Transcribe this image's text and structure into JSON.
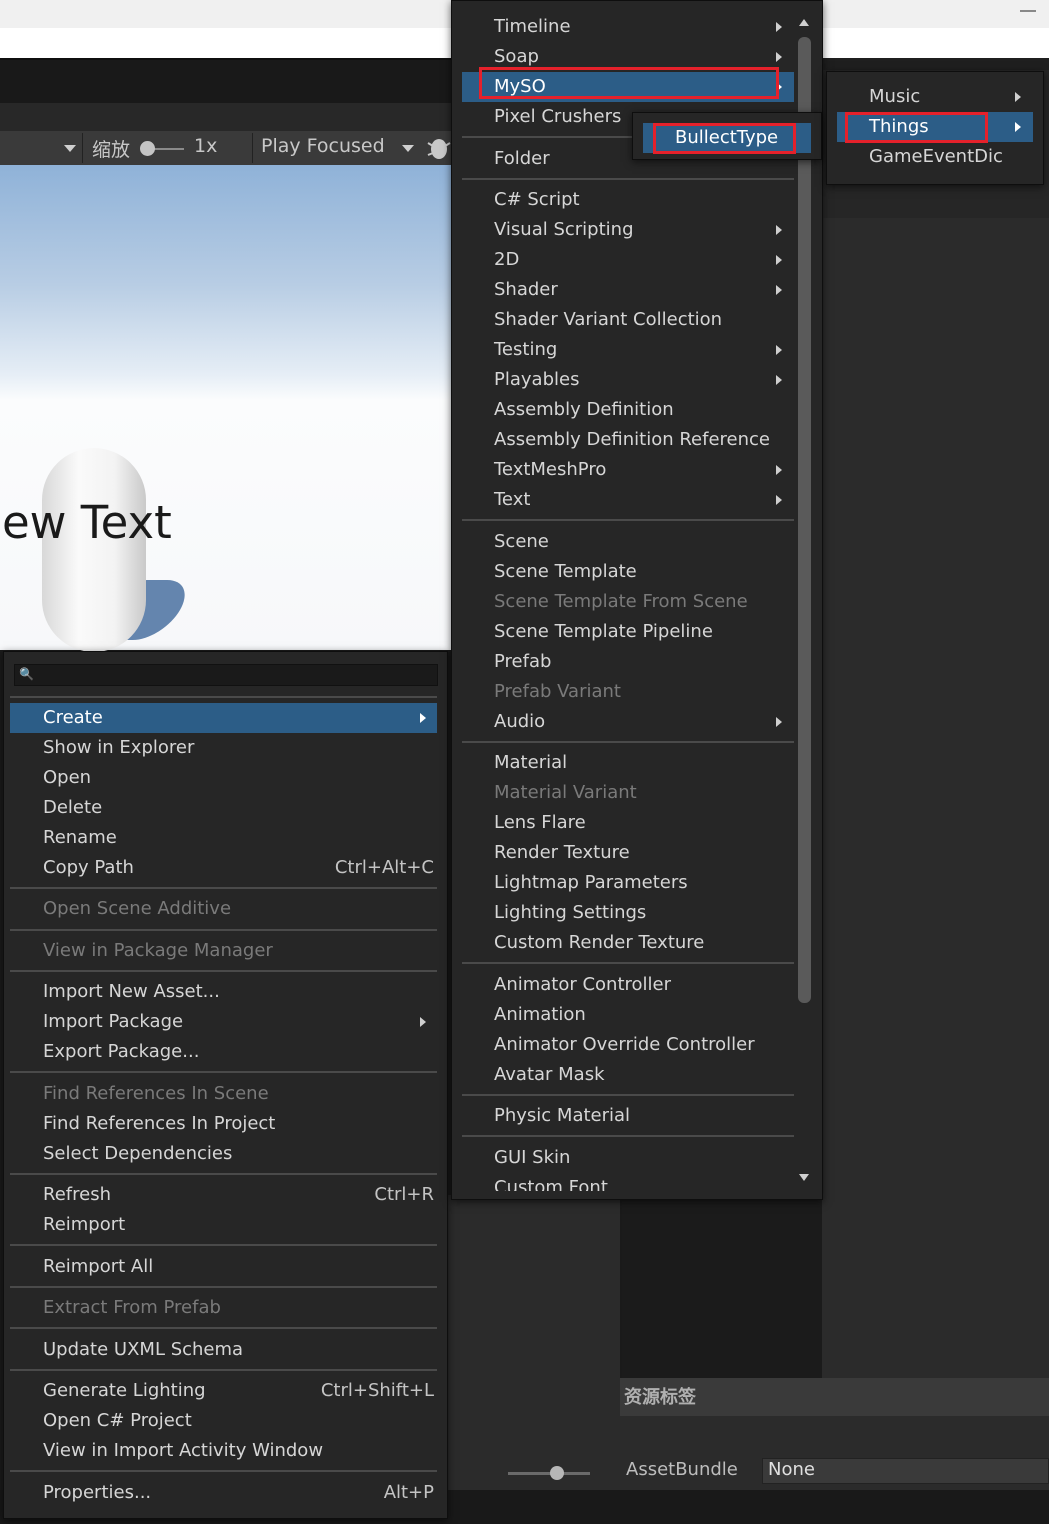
{
  "game_toolbar": {
    "scale_label": "缩放",
    "scale_value": "1x",
    "play_mode": "Play Focused"
  },
  "scene": {
    "text_label": "ew Text"
  },
  "inspector": {
    "asset_labels_title": "资源标签",
    "assetbundle_label": "AssetBundle",
    "assetbundle_value": "None"
  },
  "context_menu": {
    "search_placeholder": "",
    "items": [
      {
        "label": "Create",
        "selected": true,
        "submenu": true
      },
      {
        "label": "Show in Explorer"
      },
      {
        "label": "Open"
      },
      {
        "label": "Delete"
      },
      {
        "label": "Rename"
      },
      {
        "label": "Copy Path",
        "shortcut": "Ctrl+Alt+C"
      },
      {
        "label": "Open Scene Additive",
        "disabled": true
      },
      {
        "label": "View in Package Manager",
        "disabled": true
      },
      {
        "label": "Import New Asset..."
      },
      {
        "label": "Import Package",
        "submenu": true
      },
      {
        "label": "Export Package..."
      },
      {
        "label": "Find References In Scene",
        "disabled": true
      },
      {
        "label": "Find References In Project"
      },
      {
        "label": "Select Dependencies"
      },
      {
        "label": "Refresh",
        "shortcut": "Ctrl+R"
      },
      {
        "label": "Reimport"
      },
      {
        "label": "Reimport All"
      },
      {
        "label": "Extract From Prefab",
        "disabled": true
      },
      {
        "label": "Update UXML Schema"
      },
      {
        "label": "Generate Lighting",
        "shortcut": "Ctrl+Shift+L"
      },
      {
        "label": "Open C# Project"
      },
      {
        "label": "View in Import Activity Window"
      },
      {
        "label": "Properties...",
        "shortcut": "Alt+P"
      }
    ]
  },
  "create_menu": {
    "items": [
      {
        "label": "Timeline",
        "submenu": true
      },
      {
        "label": "Soap",
        "submenu": true
      },
      {
        "label": "MySO",
        "selected": true,
        "submenu": true
      },
      {
        "label": "Pixel Crushers",
        "submenu": true
      },
      {
        "label": "Folder"
      },
      {
        "label": "C# Script"
      },
      {
        "label": "Visual Scripting",
        "submenu": true
      },
      {
        "label": "2D",
        "submenu": true
      },
      {
        "label": "Shader",
        "submenu": true
      },
      {
        "label": "Shader Variant Collection"
      },
      {
        "label": "Testing",
        "submenu": true
      },
      {
        "label": "Playables",
        "submenu": true
      },
      {
        "label": "Assembly Definition"
      },
      {
        "label": "Assembly Definition Reference"
      },
      {
        "label": "TextMeshPro",
        "submenu": true
      },
      {
        "label": "Text",
        "submenu": true
      },
      {
        "label": "Scene"
      },
      {
        "label": "Scene Template"
      },
      {
        "label": "Scene Template From Scene",
        "disabled": true
      },
      {
        "label": "Scene Template Pipeline"
      },
      {
        "label": "Prefab"
      },
      {
        "label": "Prefab Variant",
        "disabled": true
      },
      {
        "label": "Audio",
        "submenu": true
      },
      {
        "label": "Material"
      },
      {
        "label": "Material Variant",
        "disabled": true
      },
      {
        "label": "Lens Flare"
      },
      {
        "label": "Render Texture"
      },
      {
        "label": "Lightmap Parameters"
      },
      {
        "label": "Lighting Settings"
      },
      {
        "label": "Custom Render Texture"
      },
      {
        "label": "Animator Controller"
      },
      {
        "label": "Animation"
      },
      {
        "label": "Animator Override Controller"
      },
      {
        "label": "Avatar Mask"
      },
      {
        "label": "Physic Material"
      },
      {
        "label": "GUI Skin"
      },
      {
        "label": "Custom Font"
      }
    ]
  },
  "myso_menu": {
    "items": [
      {
        "label": "BullectType",
        "selected": true
      }
    ]
  },
  "things_menu": {
    "items": [
      {
        "label": "Music",
        "submenu": true
      },
      {
        "label": "Things",
        "selected": true,
        "submenu": true
      },
      {
        "label": "GameEventDic"
      }
    ]
  },
  "colors": {
    "menu_bg": "#262626",
    "selected_bg": "#2c5d87",
    "highlight_box": "#e5212b"
  }
}
